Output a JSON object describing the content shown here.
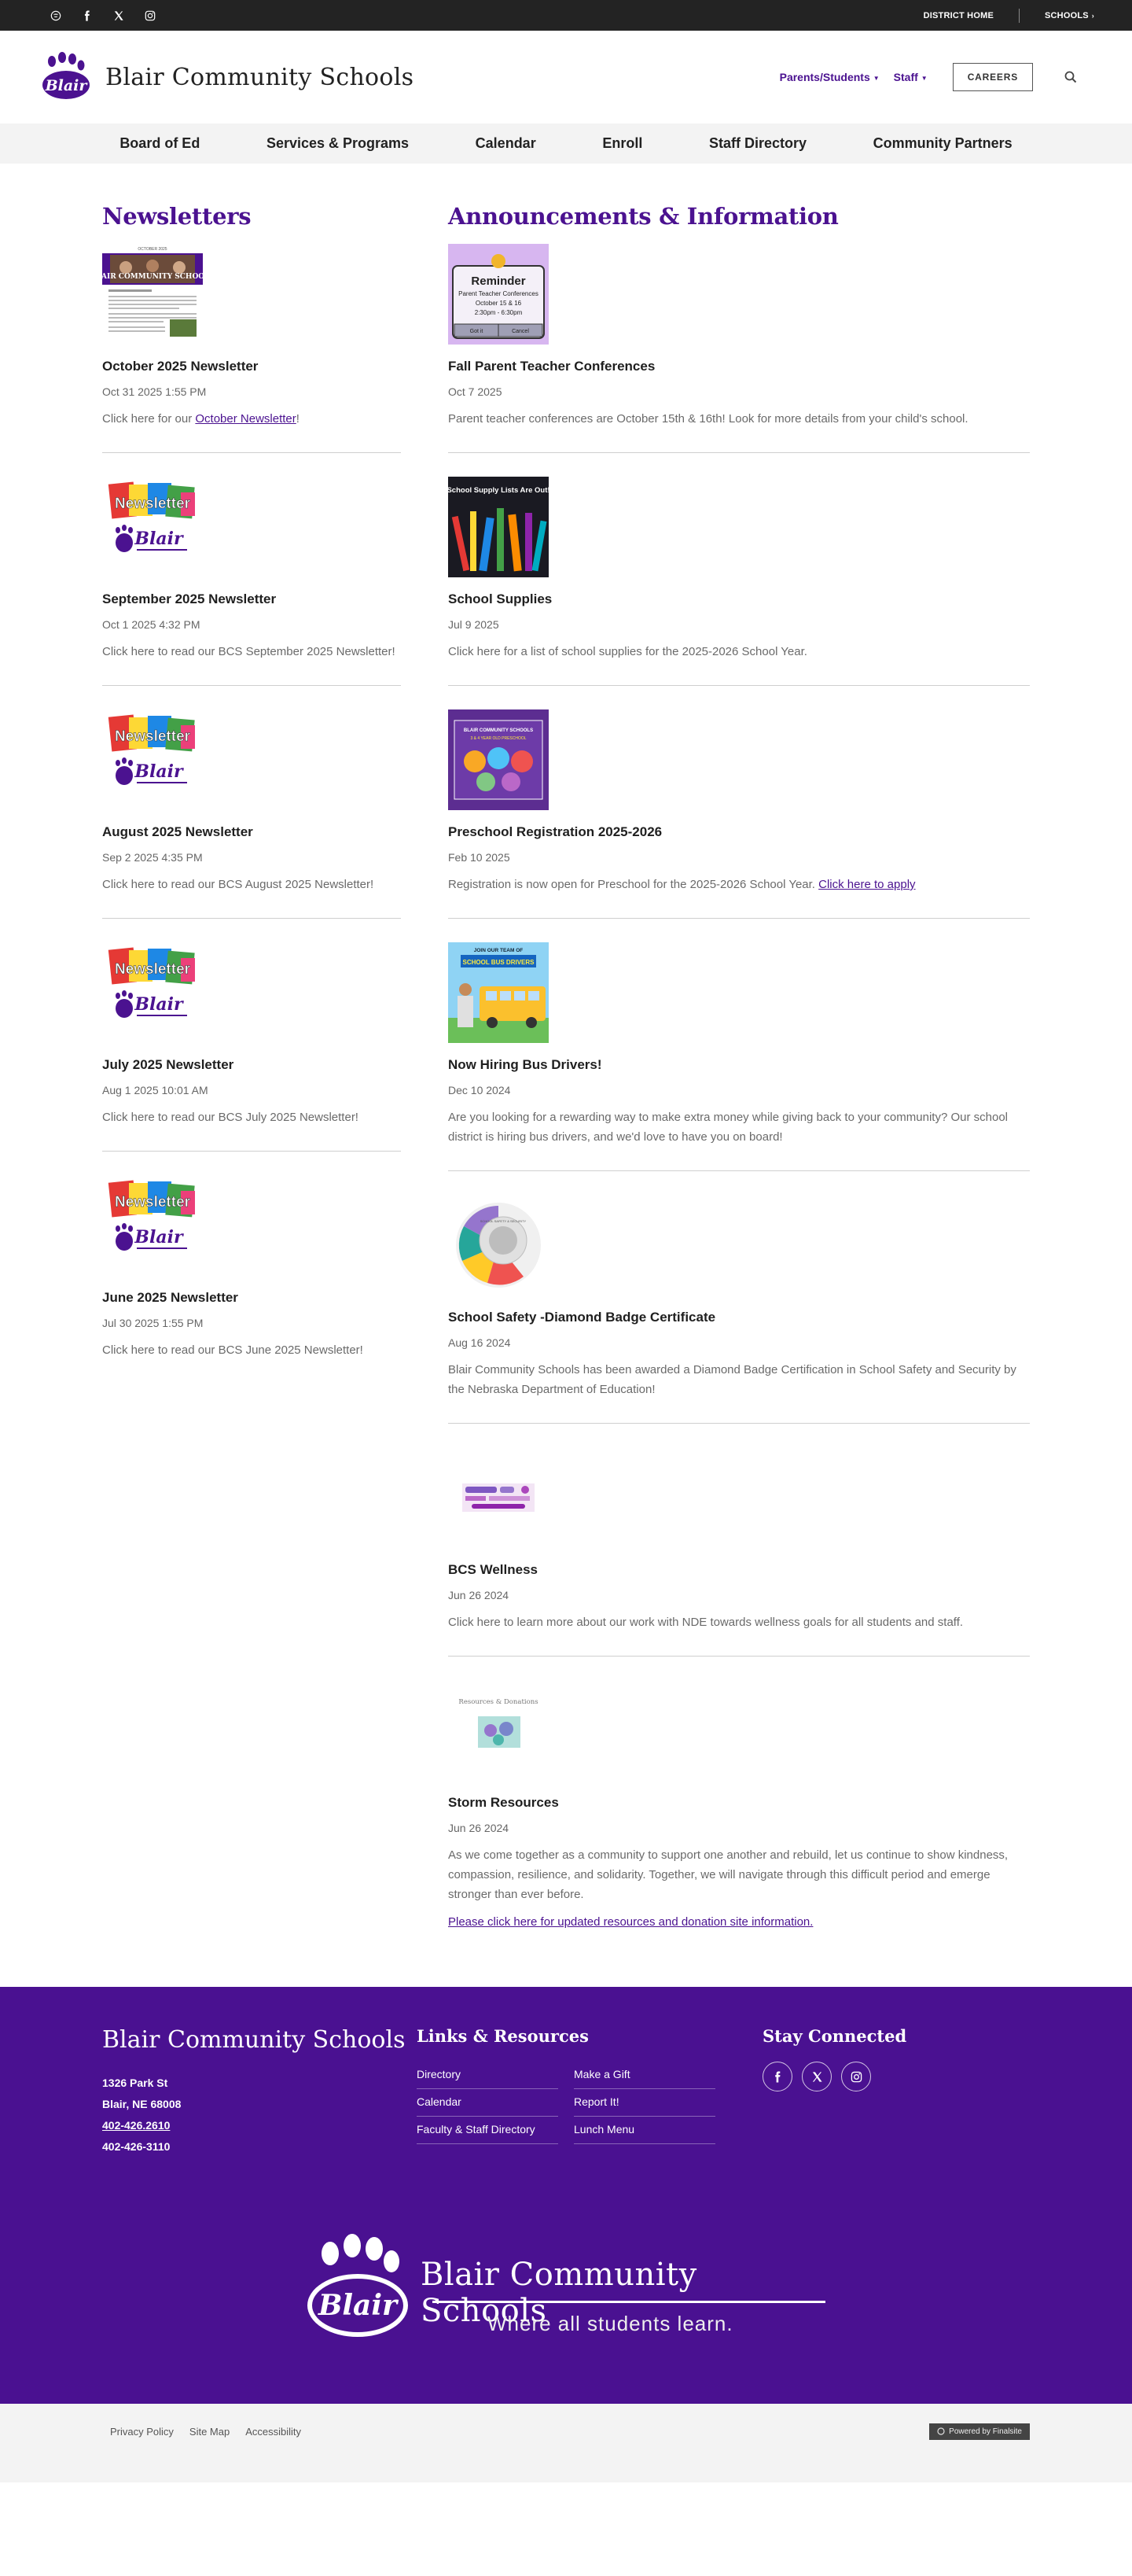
{
  "topbar": {
    "district_home": "DISTRICT HOME",
    "schools": "SCHOOLS"
  },
  "header": {
    "site_name": "Blair Community Schools",
    "logo_text": "Blair",
    "nav": [
      "Parents/Students",
      "Staff"
    ],
    "careers": "CAREERS"
  },
  "mainnav": [
    "Board of Ed",
    "Services & Programs",
    "Calendar",
    "Enroll",
    "Staff Directory",
    "Community Partners"
  ],
  "newsletters": {
    "heading": "Newsletters",
    "items": [
      {
        "title": "October 2025 Newsletter",
        "date": "Oct 31 2025 1:55 PM",
        "text_before": "Click here for our ",
        "link": "October Newsletter",
        "text_after": "!"
      },
      {
        "title": "September 2025 Newsletter",
        "date": "Oct 1 2025 4:32 PM",
        "text": "Click here to read our BCS September 2025 Newsletter!"
      },
      {
        "title": "August 2025 Newsletter",
        "date": "Sep 2 2025 4:35 PM",
        "text": "Click here to read our BCS August 2025 Newsletter!"
      },
      {
        "title": "July 2025 Newsletter",
        "date": "Aug 1 2025 10:01 AM",
        "text": "Click here to read our BCS July 2025 Newsletter!"
      },
      {
        "title": "June 2025 Newsletter",
        "date": "Jul 30 2025 1:55 PM",
        "text": "Click here to read our BCS June 2025 Newsletter!"
      }
    ],
    "thumb_text": {
      "newsletter": "Newsletter",
      "blair": "Blair",
      "oct_top": "OCTOBER 2025",
      "oct_title": "BLAIR COMMUNITY SCHOOLS"
    }
  },
  "announcements": {
    "heading": "Announcements & Information",
    "items": [
      {
        "title": "Fall Parent Teacher Conferences",
        "date": "Oct 7 2025",
        "text": "Parent teacher conferences are October 15th & 16th! Look for more details from your child's school."
      },
      {
        "title": "School Supplies",
        "date": "Jul 9 2025",
        "text": "Click here for a list of school supplies for the 2025-2026 School Year."
      },
      {
        "title": "Preschool Registration 2025-2026",
        "date": "Feb 10 2025",
        "text": "Registration is now open for Preschool for the 2025-2026 School Year. ",
        "link": "Click here to apply"
      },
      {
        "title": "Now Hiring Bus Drivers!",
        "date": "Dec 10 2024",
        "text": "Are you looking for a rewarding way to make extra money while giving back to your community? Our school district is hiring bus drivers, and we'd love to have you on board!"
      },
      {
        "title": "School Safety -Diamond Badge Certificate",
        "date": "Aug 16 2024",
        "text": "Blair Community Schools has been awarded a Diamond Badge Certification in School Safety and Security by the Nebraska Department of Education!"
      },
      {
        "title": "BCS Wellness",
        "date": "Jun 26 2024",
        "text": "Click here to learn more about our work with NDE towards wellness goals for all students and staff."
      },
      {
        "title": "Storm Resources",
        "date": "Jun 26 2024",
        "text": "As we come together as a community to support one another and rebuild, let us continue to show kindness, compassion, resilience, and solidarity. Together, we will navigate through this difficult period and emerge stronger than ever before.",
        "link": "Please click here for updated resources and donation site information."
      }
    ],
    "thumb_text": {
      "reminder": "Reminder",
      "ptc": "Parent Teacher Conferences",
      "ptc_dates": "October 15 & 16",
      "ptc_time": "2:30pm - 6:30pm",
      "ok": "Got it",
      "cancel": "Cancel",
      "supplies": "School Supply Lists Are Out!",
      "preschool": "BLAIR COMMUNITY SCHOOLS",
      "preschool_sub": "3 & 4 YEAR OLD PRESCHOOL",
      "bus_top": "JOIN OUR TEAM OF",
      "bus_main": "SCHOOL BUS DRIVERS",
      "safety": "SCHOOL SAFETY & SECURITY",
      "storm": "Resources & Donations"
    }
  },
  "footer": {
    "title": "Blair Community Schools",
    "address": [
      "1326 Park St",
      "Blair, NE  68008"
    ],
    "phone": "402-426.2610",
    "fax": "402-426-3110",
    "links_heading": "Links & Resources",
    "links": [
      "Directory",
      "Make a Gift",
      "Calendar",
      "Report It!",
      "Faculty & Staff Directory",
      "Lunch Menu"
    ],
    "stay_heading": "Stay Connected",
    "brand_name": "Blair Community Schools",
    "logo_text": "Blair",
    "tagline": "Where all students learn."
  },
  "bottom": {
    "links": [
      "Privacy Policy",
      "Site Map",
      "Accessibility"
    ],
    "powered": "Powered by Finalsite"
  },
  "colors": {
    "brand_purple": "#4b1290",
    "footer_purple": "#4a1191",
    "topbar": "#232323"
  }
}
